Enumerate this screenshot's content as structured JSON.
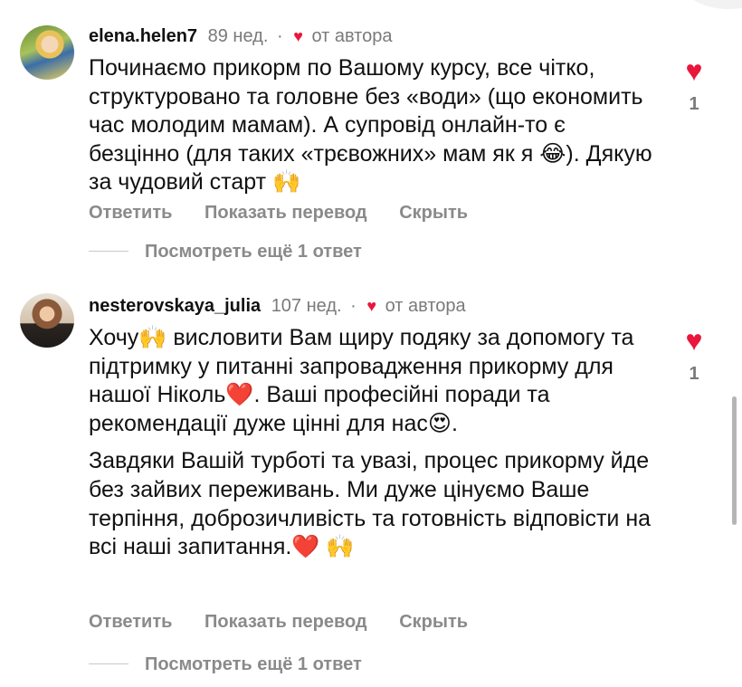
{
  "comments": [
    {
      "username": "elena.helen7",
      "age": "89 нед.",
      "separator": "·",
      "heart": "♥",
      "from_author": "от автора",
      "paragraphs": [
        "Починаємо прикорм по Вашому курсу, все чітко, структуровано та головне без «води» (що економить час молодим мамам). А супровід онлайн-то є безцінно (для таких «трєвожних» мам як я 😂). Дякую за чудовий старт 🙌"
      ],
      "like_icon": "♥",
      "likes": "1",
      "actions": {
        "reply": "Ответить",
        "translate": "Показать перевод",
        "hide": "Скрыть"
      },
      "more_replies": "Посмотреть ещё 1 ответ"
    },
    {
      "username": "nesterovskaya_julia",
      "age": "107 нед.",
      "separator": "·",
      "heart": "♥",
      "from_author": "от автора",
      "paragraphs": [
        "Хочу🙌 висловити Вам щиру подяку за допомогу та підтримку у питанні запровадження прикорму для нашої Ніколь❤️. Ваші професійні поради та рекомендації дуже цінні для нас😍.",
        "Завдяки Вашій турботі та увазі, процес прикорму йде без зайвих переживань. Ми дуже цінуємо Ваше терпіння, доброзичливість та готовність відповісти на всі наші запитання.❤️ 🙌"
      ],
      "like_icon": "♥",
      "likes": "1",
      "actions": {
        "reply": "Ответить",
        "translate": "Показать перевод",
        "hide": "Скрыть"
      },
      "more_replies": "Посмотреть ещё 1 ответ"
    }
  ],
  "colors": {
    "like_heart": "#e8173b",
    "muted_text": "#7a7a7a",
    "action_text": "#8a8a8a"
  }
}
